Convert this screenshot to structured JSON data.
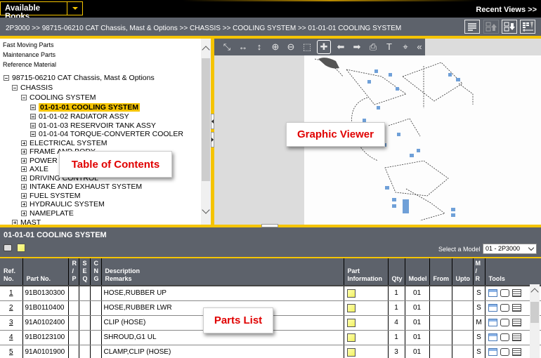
{
  "topbar": {
    "books_label": "Available Books",
    "recent_views": "Recent Views >>"
  },
  "breadcrumb": "2P3000 >> 98715-06210 CAT Chassis, Mast & Options >> CHASSIS >> COOLING SYSTEM >> 01-01-01 COOLING SYSTEM",
  "breadcrumb_tools": [
    {
      "icon": "list-view-icon"
    },
    {
      "icon": "move-up-icon",
      "disabled": true
    },
    {
      "icon": "move-down-icon"
    },
    {
      "icon": "parts-list-icon"
    }
  ],
  "toc": {
    "links": [
      "Fast Moving Parts",
      "Maintenance Parts",
      "Reference Material"
    ],
    "tree": {
      "book": "98715-06210 CAT Chassis, Mast & Options",
      "chassis": "CHASSIS",
      "cooling": "COOLING SYSTEM",
      "cooling_items": [
        "01-01-01 COOLING SYSTEM",
        "01-01-02 RADIATOR ASSY",
        "01-01-03 RESERVOIR TANK ASSY",
        "01-01-04 TORQUE-CONVERTER COOLER"
      ],
      "chassis_groups": [
        "ELECTRICAL SYSTEM",
        "FRAME AND BODY",
        "POWER LINE",
        "AXLE",
        "DRIVING CONTROL",
        "INTAKE AND EXHAUST SYSTEM",
        "FUEL SYSTEM",
        "HYDRAULIC SYSTEM",
        "NAMEPLATE"
      ],
      "mast": "MAST"
    }
  },
  "viewer": {
    "tools": [
      "fit-icon",
      "fit-width-icon",
      "fit-height-icon",
      "zoom-in-icon",
      "zoom-out-icon",
      "zoom-area-icon",
      "pan-icon",
      "previous-icon",
      "next-icon",
      "print-icon",
      "text-icon",
      "hotspot-icon",
      "collapse-icon"
    ],
    "active_tool": "pan-icon"
  },
  "parts": {
    "title": "01-01-01 COOLING SYSTEM",
    "model_label": "Select a Model",
    "model_value": "01 - 2P3000",
    "columns": {
      "ref_1": "Ref.",
      "ref_2": "No.",
      "part_no": "Part No.",
      "rp": [
        "R",
        "/",
        "P"
      ],
      "seq": [
        "S",
        "E",
        "Q"
      ],
      "cng": [
        "C",
        "N",
        "G"
      ],
      "desc_1": "Description",
      "desc_2": "Remarks",
      "pinfo_1": "Part",
      "pinfo_2": "Information",
      "qty": "Qty",
      "model": "Model",
      "from": "From",
      "upto": "Upto",
      "mr": [
        "M",
        "/",
        "R"
      ],
      "tools": "Tools"
    },
    "rows": [
      {
        "ref": "1",
        "part_no": "91B0130300",
        "desc": "HOSE,RUBBER UP",
        "qty": "1",
        "model": "01",
        "mr": "S"
      },
      {
        "ref": "2",
        "part_no": "91B0110400",
        "desc": "HOSE,RUBBER LWR",
        "qty": "1",
        "model": "01",
        "mr": "S"
      },
      {
        "ref": "3",
        "part_no": "91A0102400",
        "desc": "CLIP (HOSE)",
        "qty": "4",
        "model": "01",
        "mr": "M"
      },
      {
        "ref": "4",
        "part_no": "91B0123100",
        "desc": "SHROUD,G1 UL",
        "qty": "1",
        "model": "01",
        "mr": "S"
      },
      {
        "ref": "5",
        "part_no": "91A0101900",
        "desc": "CLAMP,CLIP (HOSE)",
        "qty": "3",
        "model": "01",
        "mr": "S"
      }
    ]
  },
  "callouts": {
    "toc": "Table of Contents",
    "viewer": "Graphic Viewer",
    "parts": "Parts List"
  }
}
